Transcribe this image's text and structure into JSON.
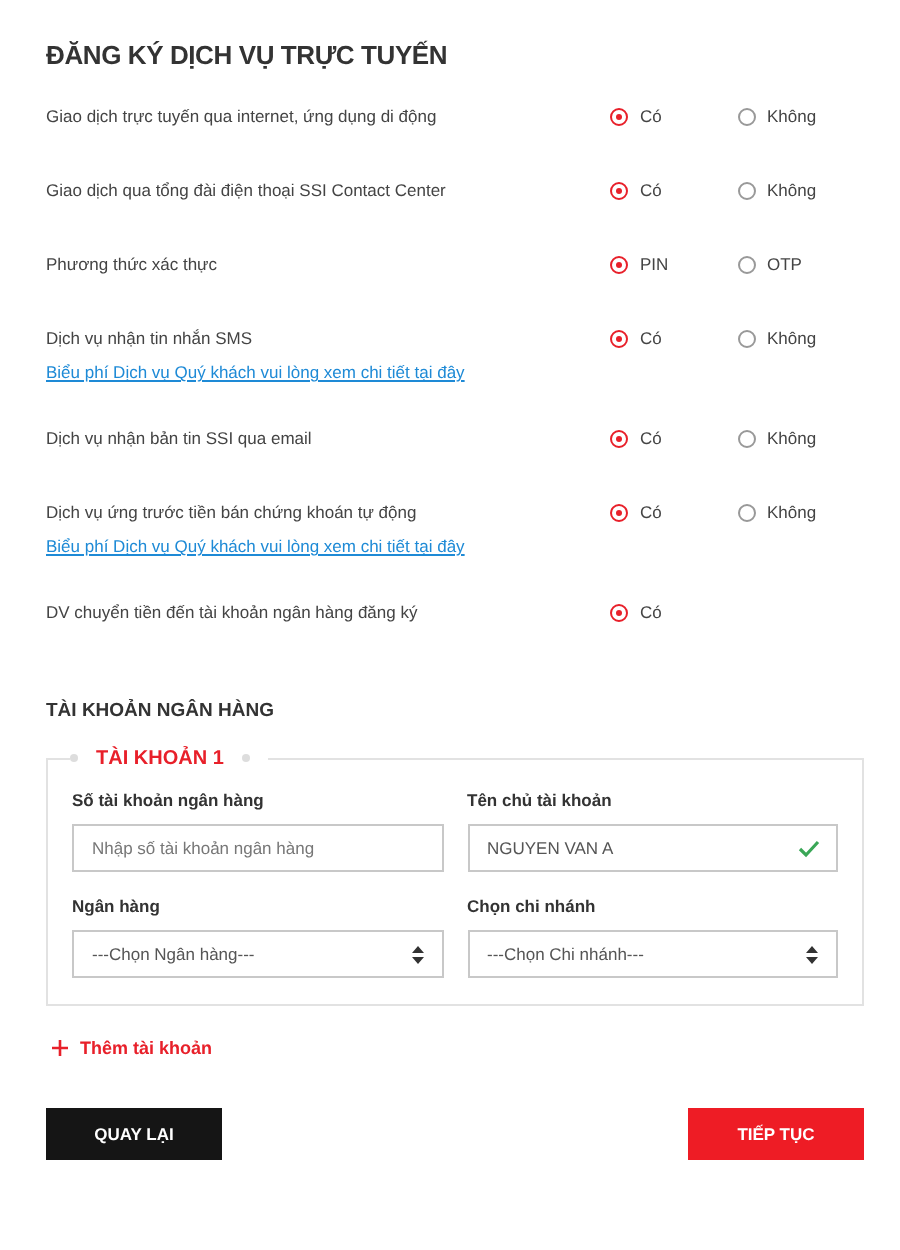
{
  "title": "ĐĂNG KÝ DỊCH VỤ TRỰC TUYẾN",
  "services": [
    {
      "label": "Giao dịch trực tuyến qua internet, ứng dụng di động",
      "options": [
        {
          "label": "Có",
          "selected": true
        },
        {
          "label": "Không",
          "selected": false
        }
      ]
    },
    {
      "label": "Giao dịch qua tổng đài điện thoại SSI Contact Center",
      "options": [
        {
          "label": "Có",
          "selected": true
        },
        {
          "label": "Không",
          "selected": false
        }
      ]
    },
    {
      "label": "Phương thức xác thực",
      "options": [
        {
          "label": "PIN",
          "selected": true
        },
        {
          "label": "OTP",
          "selected": false
        }
      ]
    },
    {
      "label": "Dịch vụ nhận tin nhắn SMS",
      "link": "Biểu phí Dịch vụ Quý khách vui lòng xem chi tiết tại đây",
      "options": [
        {
          "label": "Có",
          "selected": true
        },
        {
          "label": "Không",
          "selected": false
        }
      ]
    },
    {
      "label": "Dịch vụ nhận bản tin SSI qua email",
      "options": [
        {
          "label": "Có",
          "selected": true
        },
        {
          "label": "Không",
          "selected": false
        }
      ]
    },
    {
      "label": "Dịch vụ ứng trước tiền bán chứng khoán tự động",
      "link": "Biểu phí Dịch vụ Quý khách vui lòng xem chi tiết tại đây",
      "options": [
        {
          "label": "Có",
          "selected": true
        },
        {
          "label": "Không",
          "selected": false
        }
      ]
    },
    {
      "label": "DV chuyển tiền đến tài khoản ngân hàng đăng ký",
      "options": [
        {
          "label": "Có",
          "selected": true
        }
      ]
    }
  ],
  "bank_section": {
    "title": "TÀI KHOẢN NGÂN HÀNG",
    "account_legend": "TÀI KHOẢN 1",
    "fields": [
      {
        "kind": "input",
        "label": "Số tài khoản ngân hàng",
        "placeholder": "Nhập số tài khoản ngân hàng"
      },
      {
        "kind": "input",
        "label": "Tên chủ tài khoản",
        "value": "NGUYEN VAN A",
        "valid": true
      },
      {
        "kind": "select",
        "label": "Ngân hàng",
        "value": "---Chọn Ngân hàng---"
      },
      {
        "kind": "select",
        "label": "Chọn chi nhánh",
        "value": "---Chọn Chi nhánh---"
      }
    ],
    "add_link": "Thêm tài khoản"
  },
  "buttons": {
    "back": "QUAY LẠI",
    "next": "TIẾP TỤC"
  }
}
